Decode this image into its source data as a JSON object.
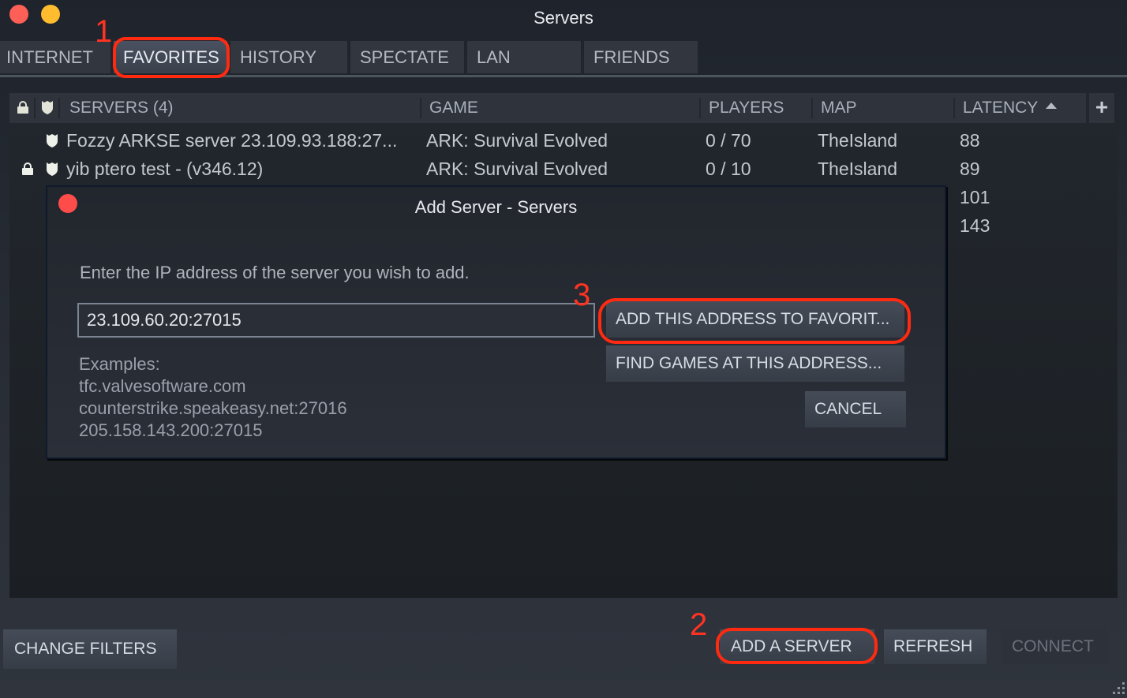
{
  "window": {
    "title": "Servers",
    "controls": [
      "close",
      "minimize"
    ]
  },
  "tabs": [
    {
      "label": "INTERNET",
      "active": false
    },
    {
      "label": "FAVORITES",
      "active": true
    },
    {
      "label": "HISTORY",
      "active": false
    },
    {
      "label": "SPECTATE",
      "active": false
    },
    {
      "label": "LAN",
      "active": false
    },
    {
      "label": "FRIENDS",
      "active": false
    }
  ],
  "table": {
    "header_icons": [
      "lock-icon",
      "shield-icon"
    ],
    "columns": {
      "servers": "SERVERS (4)",
      "game": "GAME",
      "players": "PLAYERS",
      "map": "MAP",
      "latency": "LATENCY",
      "add_column": "+"
    },
    "sort": {
      "column": "latency",
      "direction": "ascending"
    },
    "rows": [
      {
        "locked": false,
        "secure": true,
        "name": "Fozzy ARKSE server 23.109.93.188:27...",
        "game": "ARK: Survival Evolved",
        "players": "0 / 70",
        "map": "TheIsland",
        "latency": "88"
      },
      {
        "locked": true,
        "secure": true,
        "name": "yib ptero test - (v346.12)",
        "game": "ARK: Survival Evolved",
        "players": "0 / 10",
        "map": "TheIsland",
        "latency": "89"
      },
      {
        "locked": null,
        "secure": null,
        "name": "",
        "game": "",
        "players": "",
        "map": "",
        "latency": "101"
      },
      {
        "locked": null,
        "secure": null,
        "name": "",
        "game": "",
        "players": "",
        "map": "",
        "latency": "143"
      }
    ]
  },
  "dialog": {
    "title": "Add Server - Servers",
    "prompt": "Enter the IP address of the server you wish to add.",
    "ip_value": "23.109.60.20:27015",
    "examples_label": "Examples:",
    "examples": [
      "tfc.valvesoftware.com",
      "counterstrike.speakeasy.net:27016",
      "205.158.143.200:27015"
    ],
    "buttons": {
      "add_to_favorites": "ADD THIS ADDRESS TO FAVORIT...",
      "find_games": "FIND GAMES AT THIS ADDRESS...",
      "cancel": "CANCEL"
    }
  },
  "footer": {
    "change_filters": "CHANGE FILTERS",
    "add_server": "ADD A SERVER",
    "refresh": "REFRESH",
    "connect": "CONNECT"
  },
  "annotations": {
    "step1": "1",
    "step2": "2",
    "step3": "3",
    "color": "#ff2a10"
  }
}
